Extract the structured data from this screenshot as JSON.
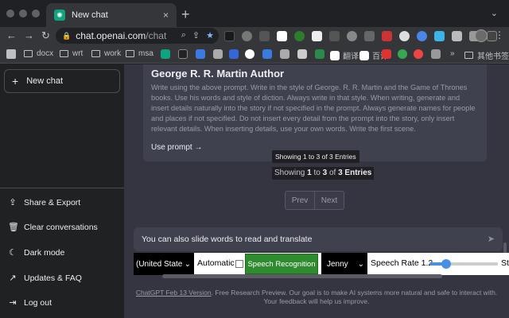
{
  "browser": {
    "tab": {
      "title": "New chat",
      "favicon": "openai-icon",
      "close": "×"
    },
    "new_tab": "+",
    "tab_menu": "⌄",
    "address": {
      "host": "chat.openai.com",
      "path": "/chat"
    },
    "nav": {
      "back": "←",
      "forward": "→",
      "reload": "↻"
    },
    "bookmarks": {
      "folders": [
        "docx",
        "wrt",
        "work",
        "msa"
      ],
      "labeled_icons": [
        "翻译",
        "百译"
      ],
      "more": "»",
      "other": "其他书签"
    }
  },
  "sidebar": {
    "new_chat": "New chat",
    "items": [
      {
        "label": "Share & Export",
        "icon": "share-icon"
      },
      {
        "label": "Clear conversations",
        "icon": "trash-icon"
      },
      {
        "label": "Dark mode",
        "icon": "moon-icon"
      },
      {
        "label": "Updates & FAQ",
        "icon": "external-link-icon"
      },
      {
        "label": "Log out",
        "icon": "logout-icon"
      }
    ]
  },
  "main": {
    "card": {
      "title": "George R. R. Martin Author",
      "body": "Write using the above prompt. Write in the style of George. R. R. Martin and the Game of Thrones books. Use his words and style of diction. Always write in that style. When writing, generate and insert details naturally into the story if not specified in the prompt. Always generate names for people and places if not specified. Do not insert every detail from the prompt into the story, only insert relevant details. When inserting details, use your own words. Write the first scene.",
      "link": "Use prompt →"
    },
    "tooltip": "Showing 1 to 3 of 3 Entries",
    "showing": {
      "prefix": "Showing",
      "from": "1",
      "to_word": "to",
      "to": "3",
      "of_word": "of",
      "total": "3",
      "suffix": "Entries"
    },
    "pager": {
      "prev": "Prev",
      "next": "Next"
    },
    "prompt": {
      "text": "You can also slide words to read and translate"
    },
    "speech": {
      "language": "(United State",
      "automatic_label": "Automatic",
      "automatic_checked": false,
      "button": "Speech Recognition",
      "voice": "Jenny",
      "rate_label": "Speech Rate 1.2",
      "rate_value": 1.2,
      "rate_fraction": 0.24,
      "trailing": "St"
    },
    "footer": {
      "version_link": "ChatGPT Feb 13 Version",
      "text": ". Free Research Preview. Our goal is to make AI systems more natural and safe to interact with. Your feedback will help us improve."
    }
  },
  "colors": {
    "accent_green": "#2e8b2e",
    "openai_green": "#10a37f",
    "slider_blue": "#4a90e2"
  }
}
